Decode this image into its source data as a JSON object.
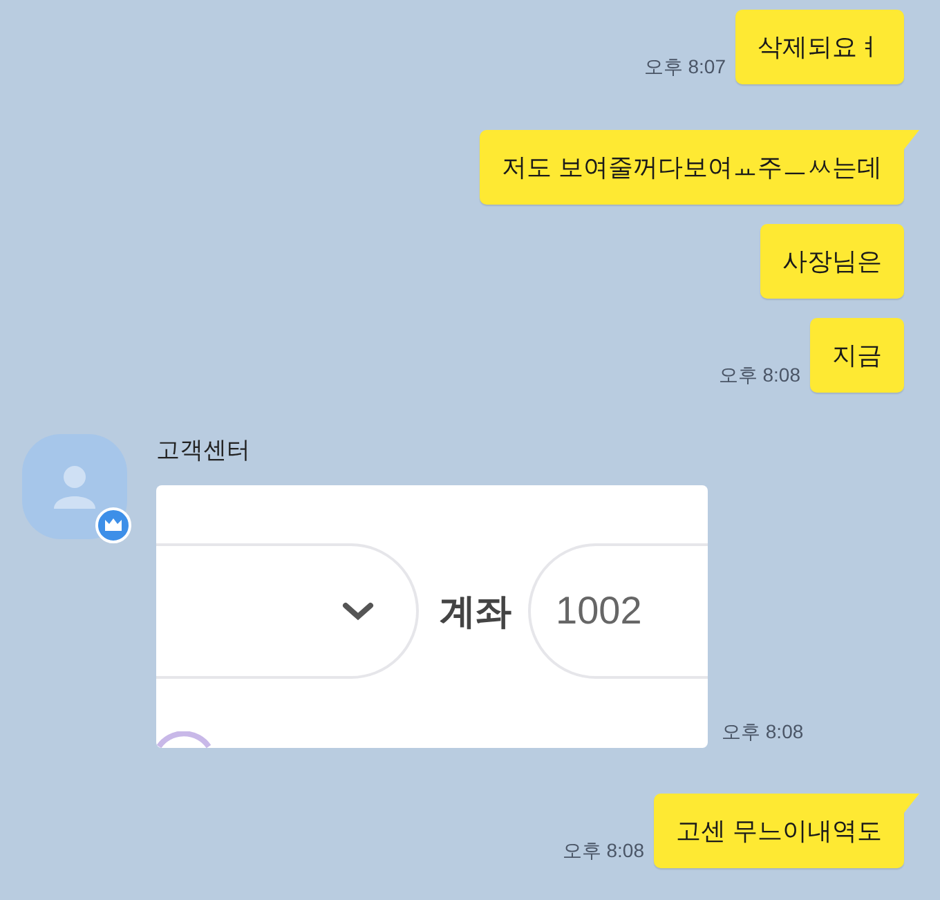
{
  "messages": [
    {
      "kind": "sent",
      "text": "삭제되요ㅕ",
      "time": "오후 8:07",
      "tail": false
    },
    {
      "kind": "sent",
      "text": "저도 보여줄꺼다보여ㅛ주ㅡㅆ는데",
      "tail": true
    },
    {
      "kind": "sent",
      "text": "사장님은",
      "tail": false
    },
    {
      "kind": "sent",
      "text": "지금",
      "time": "오후 8:08",
      "tail": false
    },
    {
      "kind": "received",
      "sender": "고객센터",
      "time": "오후 8:08",
      "image": {
        "label": "계좌",
        "value": "1002"
      }
    },
    {
      "kind": "sent",
      "text": "고센 무느이내역도",
      "time": "오후 8:08",
      "tail": true
    }
  ]
}
